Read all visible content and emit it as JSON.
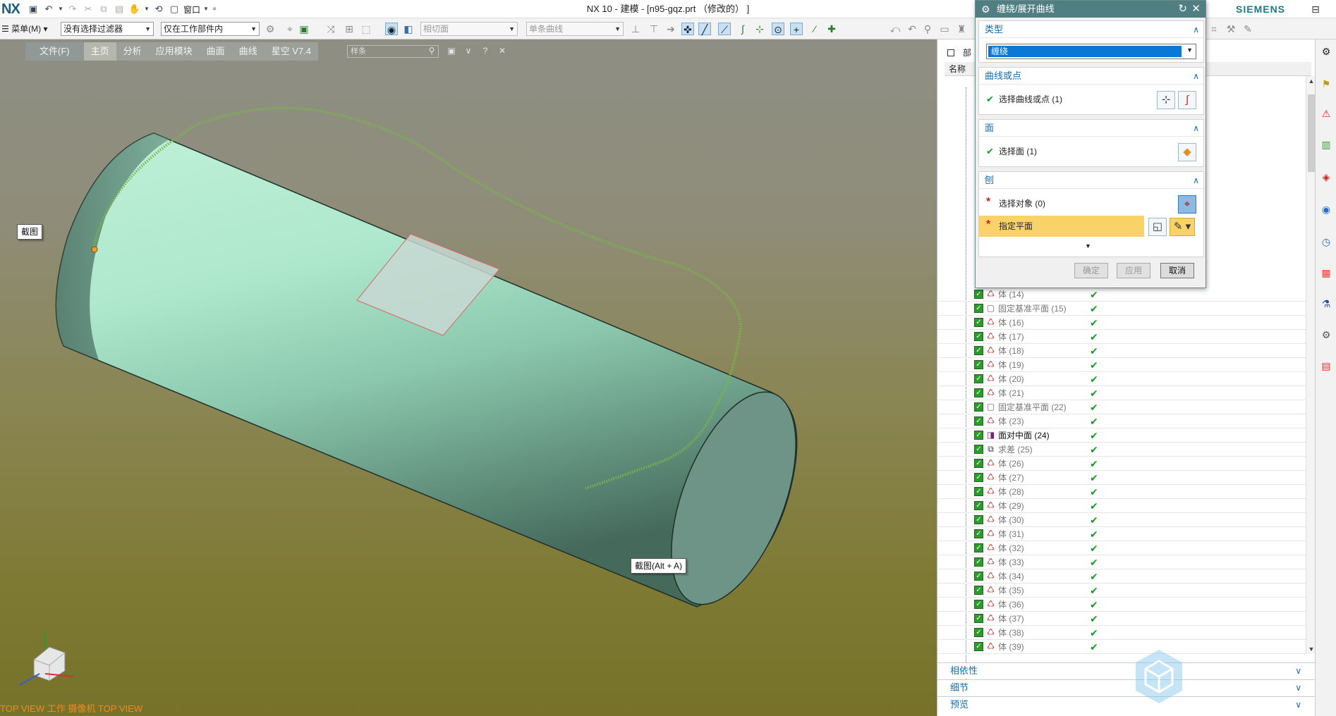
{
  "titlebar": {
    "logo": "NX",
    "title": "NX 10 - 建模 - [n95-gqz.prt （修改的） ]",
    "brand": "SIEMENS",
    "window_btn": "⊟",
    "quick_access": {
      "window_menu": "窗口"
    }
  },
  "toolbar2": {
    "menu_label": "菜单(M)",
    "selection_filter": "没有选择过滤器",
    "assembly_scope": "仅在工作部件内",
    "face_rule": "相切面",
    "curve_rule": "单条曲线"
  },
  "ribbon": {
    "tabs": [
      "文件(F)",
      "主页",
      "分析",
      "应用模块",
      "曲面",
      "曲线",
      "星空 V7.4"
    ],
    "search_placeholder": "样条"
  },
  "viewport": {
    "tooltip_left": "截图",
    "tooltip_mid": "截图(Alt + A)",
    "view_status": "TOP VIEW 工作 摄像机 TOP VIEW"
  },
  "navigator": {
    "header": "部",
    "col_name": "名称",
    "rows": [
      {
        "name": "体 (14)",
        "type": "body"
      },
      {
        "name": "固定基准平面 (15)",
        "type": "plane"
      },
      {
        "name": "体 (16)",
        "type": "body"
      },
      {
        "name": "体 (17)",
        "type": "body"
      },
      {
        "name": "体 (18)",
        "type": "body"
      },
      {
        "name": "体 (19)",
        "type": "body"
      },
      {
        "name": "体 (20)",
        "type": "body"
      },
      {
        "name": "体 (21)",
        "type": "body"
      },
      {
        "name": "固定基准平面 (22)",
        "type": "plane"
      },
      {
        "name": "体 (23)",
        "type": "body"
      },
      {
        "name": "面对中面 (24)",
        "type": "mid"
      },
      {
        "name": "求差 (25)",
        "type": "sub"
      },
      {
        "name": "体 (26)",
        "type": "body"
      },
      {
        "name": "体 (27)",
        "type": "body"
      },
      {
        "name": "体 (28)",
        "type": "body"
      },
      {
        "name": "体 (29)",
        "type": "body"
      },
      {
        "name": "体 (30)",
        "type": "body"
      },
      {
        "name": "体 (31)",
        "type": "body"
      },
      {
        "name": "体 (32)",
        "type": "body"
      },
      {
        "name": "体 (33)",
        "type": "body"
      },
      {
        "name": "体 (34)",
        "type": "body"
      },
      {
        "name": "体 (35)",
        "type": "body"
      },
      {
        "name": "体 (36)",
        "type": "body"
      },
      {
        "name": "体 (37)",
        "type": "body"
      },
      {
        "name": "体 (38)",
        "type": "body"
      },
      {
        "name": "体 (39)",
        "type": "body"
      }
    ],
    "sections": [
      "相依性",
      "细节",
      "预览"
    ]
  },
  "dialog": {
    "title": "缠绕/展开曲线",
    "type_group": "类型",
    "type_value": "缠绕",
    "curve_group": "曲线或点",
    "curve_select": "选择曲线或点 (1)",
    "face_group": "面",
    "face_select": "选择面 (1)",
    "plane_group": "刨",
    "plane_select": "选择对象 (0)",
    "plane_specify": "指定平面",
    "btn_ok": "确定",
    "btn_apply": "应用",
    "btn_cancel": "取消"
  },
  "colors": {
    "dialog_title": "#4f7f83",
    "highlight": "#f9d36a",
    "accent": "#1a6aa8",
    "check": "#1a9a2a",
    "cylinder": "#a8e6c8"
  }
}
